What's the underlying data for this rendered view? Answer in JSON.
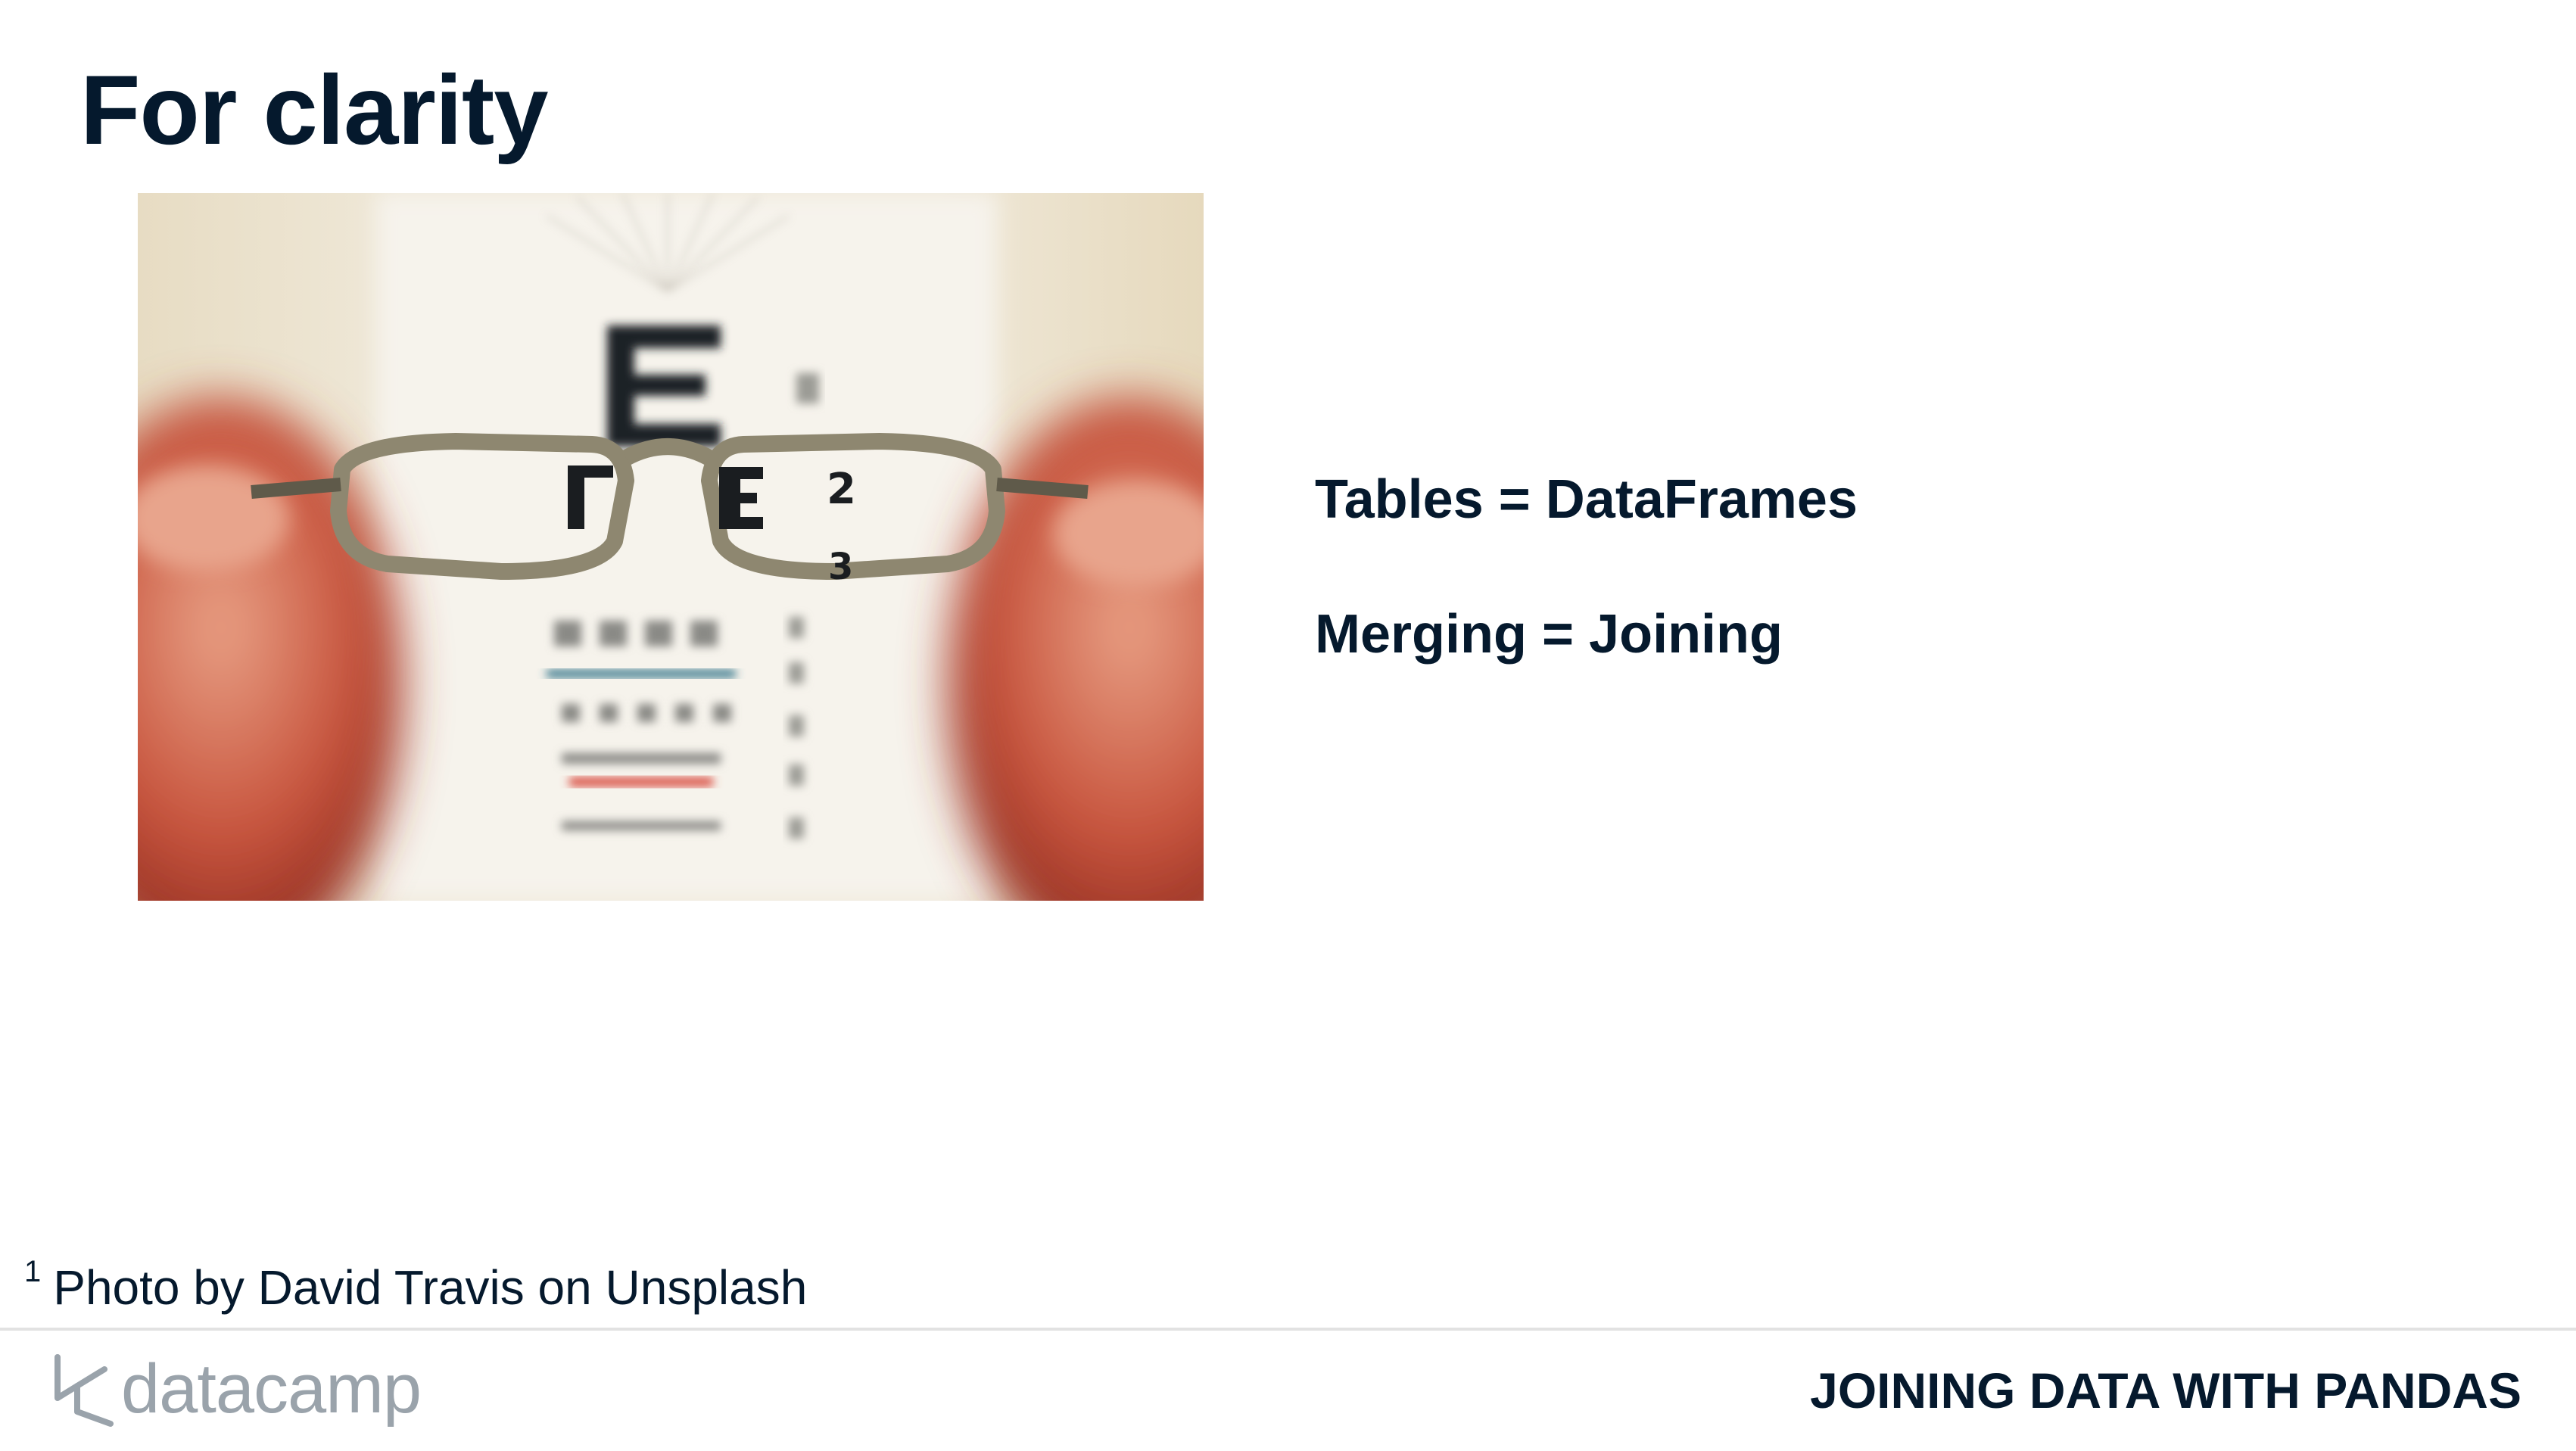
{
  "slide": {
    "title": "For clarity",
    "bullets": [
      "Tables = DataFrames",
      "Merging = Joining"
    ],
    "photo": {
      "description_icon": "eyeglasses-eye-chart-photo",
      "chart_letters": [
        "E",
        "2",
        "3",
        "4",
        "5",
        "6",
        "7",
        "8",
        "1"
      ]
    },
    "footnote": {
      "marker": "1",
      "text": "Photo by David Travis on Unsplash"
    }
  },
  "footer": {
    "brand": "datacamp",
    "course": "JOINING DATA WITH PANDAS"
  },
  "colors": {
    "text": "#05192d",
    "logo_gray": "#9aa3ab",
    "rule": "#e2e2e2"
  }
}
